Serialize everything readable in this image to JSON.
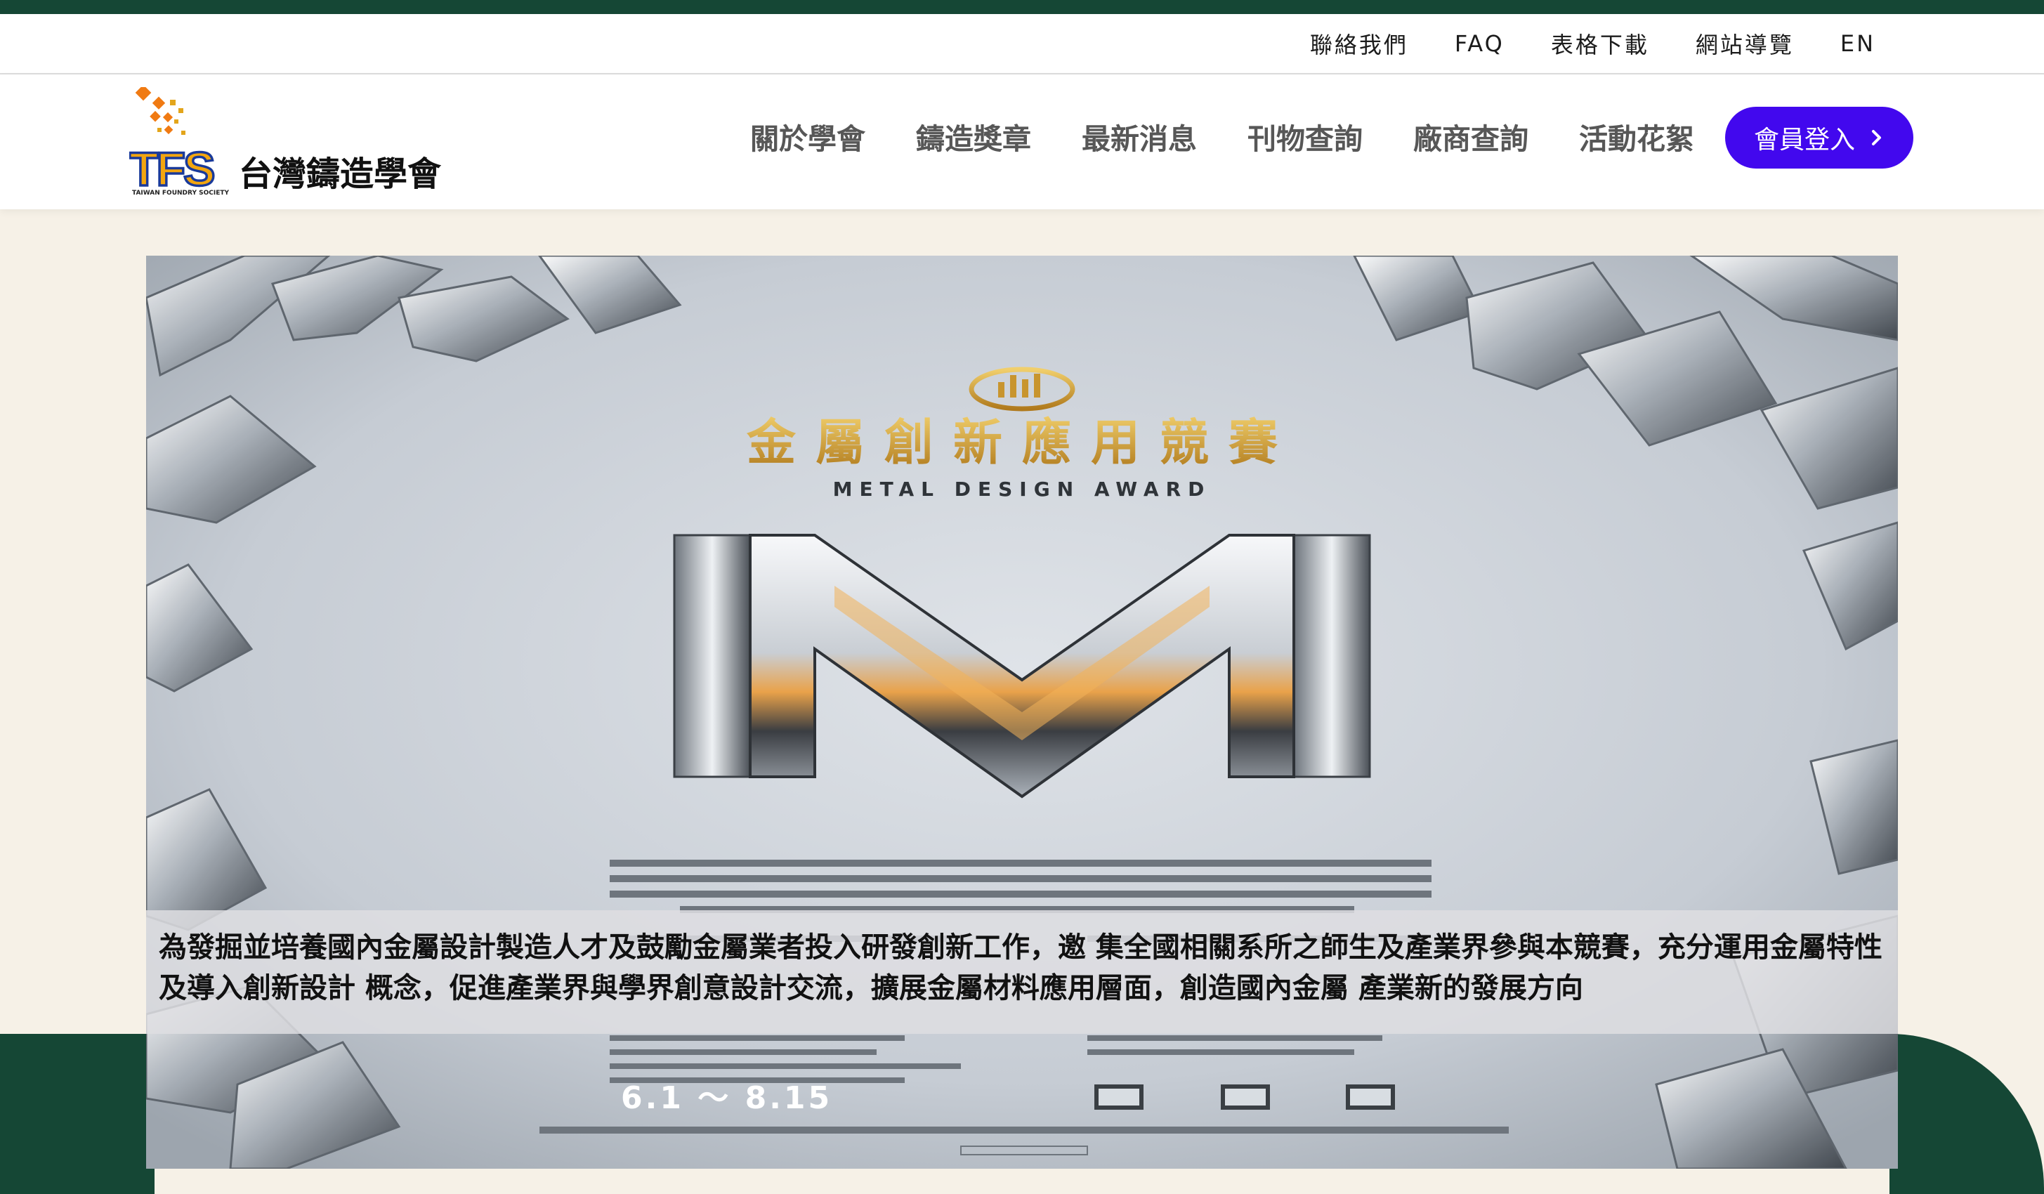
{
  "utility_nav": [
    "聯絡我們",
    "FAQ",
    "表格下載",
    "網站導覽",
    "EN"
  ],
  "logo": {
    "mark_text": "TFS",
    "name": "台灣鑄造學會",
    "subtitle": "TAIWAN FOUNDRY SOCIETY"
  },
  "main_nav": [
    "關於學會",
    "鑄造獎章",
    "最新消息",
    "刊物查詢",
    "廠商查詢",
    "活動花絮"
  ],
  "login": {
    "label": "會員登入"
  },
  "banner": {
    "title_zh": "金屬創新應用競賽",
    "title_en": "METAL DESIGN AWARD",
    "emblem_text": "M",
    "date_range": "6.1 ～ 8.15",
    "caption": "為發掘並培養國內金屬設計製造人才及鼓勵金屬業者投入研發創新工作，邀 集全國相關系所之師生及產業界參與本競賽，充分運用金屬特性及導入創新設計 概念，促進產業界與學界創意設計交流，擴展金屬材料應用層面，創造國內金屬 產業新的發展方向"
  },
  "colors": {
    "brand_green": "#154735",
    "login_purple": "#4208ee",
    "page_cream": "#f6f1e7",
    "nav_gray": "#575757",
    "gold": "#c8952e"
  },
  "icons": [
    "chevron-right-icon",
    "tfs-logo-icon",
    "trophy-emblem-icon",
    "qr-code-icon"
  ]
}
